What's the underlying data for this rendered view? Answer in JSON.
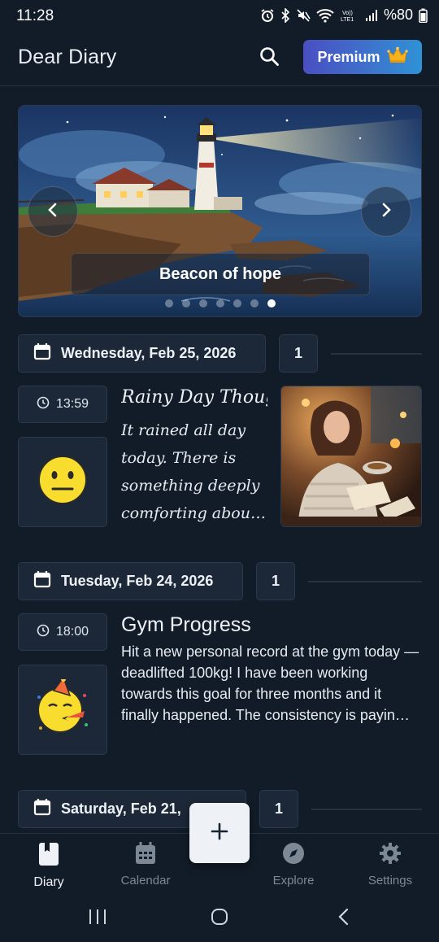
{
  "status_bar": {
    "time": "11:28",
    "battery": "%80",
    "icons": [
      "alarm-icon",
      "bluetooth-icon",
      "mute-icon",
      "wifi-icon",
      "volte-icon",
      "signal-icon",
      "battery-icon"
    ]
  },
  "app_bar": {
    "title": "Dear Diary",
    "search_icon": "search-icon",
    "premium_label": "Premium",
    "premium_icon": "crown-icon"
  },
  "banner": {
    "caption": "Beacon of hope",
    "slide_count": 7,
    "active_slide": 7,
    "prev_icon": "chevron-left-icon",
    "next_icon": "chevron-right-icon"
  },
  "days": [
    {
      "date": "Wednesday, Feb 25, 2026",
      "count": "1",
      "entry": {
        "time": "13:59",
        "mood_icon": "neutral-face-icon",
        "title": "Rainy Day Thoug...",
        "body": "It rained all day today. There is something deeply comforting about ...",
        "has_photo": true
      }
    },
    {
      "date": "Tuesday, Feb 24, 2026",
      "count": "1",
      "entry": {
        "time": "18:00",
        "mood_icon": "partying-face-icon",
        "title": "Gym Progress",
        "body": "Hit a new personal record at the gym today — deadlifted 100kg! I have been working towards this goal for three months and it finally happened. The consistency is payin…",
        "has_photo": false
      }
    },
    {
      "date": "Saturday, Feb 21,",
      "count": "1"
    }
  ],
  "fab": {
    "icon": "plus-icon"
  },
  "bottom_nav": {
    "items": [
      {
        "label": "Diary",
        "icon": "diary-icon",
        "active": true
      },
      {
        "label": "Calendar",
        "icon": "calendar-icon",
        "active": false
      },
      {
        "label": "Explore",
        "icon": "compass-icon",
        "active": false
      },
      {
        "label": "Settings",
        "icon": "gear-icon",
        "active": false
      }
    ]
  },
  "colors": {
    "background": "#121c28",
    "card": "#1c2838",
    "premium_gradient_start": "#4a4fc2",
    "premium_gradient_end": "#2f92d6",
    "emoji_yellow": "#f8dd2e"
  }
}
